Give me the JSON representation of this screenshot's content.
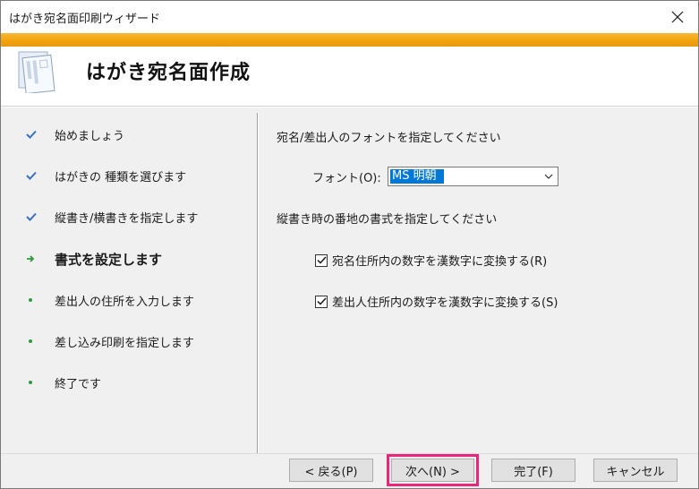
{
  "window": {
    "title": "はがき宛名面印刷ウィザード",
    "close_glyph": "✕"
  },
  "header": {
    "heading": "はがき宛名面作成",
    "logo_icon": "postcard-wizard-icon"
  },
  "colors": {
    "accent": "#f2a20c",
    "check": "#3b6fc4",
    "arrow": "#2f9a3e",
    "highlight": "#e8267a",
    "selection": "#0078d7"
  },
  "steps": [
    {
      "label": "始めましょう",
      "state": "done",
      "icon": "checkmark-icon"
    },
    {
      "label": "はがきの 種類を選びます",
      "state": "done",
      "icon": "checkmark-icon"
    },
    {
      "label": "縦書き/横書きを指定します",
      "state": "done",
      "icon": "checkmark-icon"
    },
    {
      "label": "書式を設定します",
      "state": "current",
      "icon": "arrow-right-icon"
    },
    {
      "label": "差出人の住所を入力します",
      "state": "pending",
      "icon": "bullet-icon"
    },
    {
      "label": "差し込み印刷を指定します",
      "state": "pending",
      "icon": "bullet-icon"
    },
    {
      "label": "終了です",
      "state": "pending",
      "icon": "bullet-icon"
    }
  ],
  "panel": {
    "font_section_label": "宛名/差出人のフォントを指定してください",
    "font_label": "フォント(O):",
    "font_value": "MS 明朝",
    "address_section_label": "縦書き時の番地の書式を指定してください",
    "checkbox1": {
      "label": "宛名住所内の数字を漢数字に変換する(R)",
      "checked": true
    },
    "checkbox2": {
      "label": "差出人住所内の数字を漢数字に変換する(S)",
      "checked": true
    }
  },
  "footer": {
    "back": "< 戻る(P)",
    "next": "次へ(N) >",
    "finish": "完了(F)",
    "cancel": "キャンセル"
  }
}
